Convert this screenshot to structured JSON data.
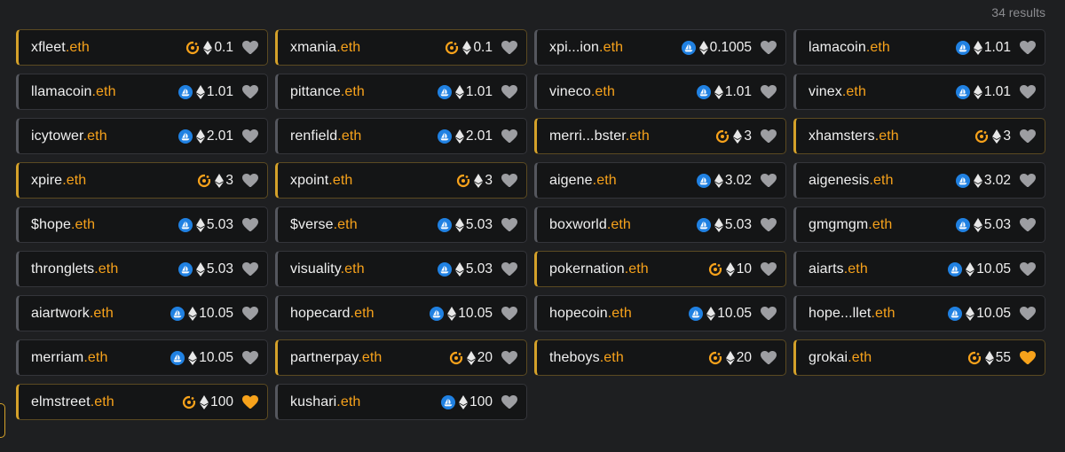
{
  "results_label": "34 results",
  "colors": {
    "tld": "#f7a21b",
    "heart_active": "#f7a21b",
    "heart_inactive": "#9d9ea2",
    "opensea_blue": "#2081e2"
  },
  "listings": [
    {
      "name": "xfleet",
      "tld": ".eth",
      "marketplace": "ens-marketplace-icon",
      "price": "0.1",
      "liked": false,
      "highlight": true
    },
    {
      "name": "xmania",
      "tld": ".eth",
      "marketplace": "ens-marketplace-icon",
      "price": "0.1",
      "liked": false,
      "highlight": true
    },
    {
      "name": "xpi...ion",
      "tld": ".eth",
      "marketplace": "opensea-icon",
      "price": "0.1005",
      "liked": false,
      "highlight": false
    },
    {
      "name": "lamacoin",
      "tld": ".eth",
      "marketplace": "opensea-icon",
      "price": "1.01",
      "liked": false,
      "highlight": false
    },
    {
      "name": "llamacoin",
      "tld": ".eth",
      "marketplace": "opensea-icon",
      "price": "1.01",
      "liked": false,
      "highlight": false
    },
    {
      "name": "pittance",
      "tld": ".eth",
      "marketplace": "opensea-icon",
      "price": "1.01",
      "liked": false,
      "highlight": false
    },
    {
      "name": "vineco",
      "tld": ".eth",
      "marketplace": "opensea-icon",
      "price": "1.01",
      "liked": false,
      "highlight": false
    },
    {
      "name": "vinex",
      "tld": ".eth",
      "marketplace": "opensea-icon",
      "price": "1.01",
      "liked": false,
      "highlight": false
    },
    {
      "name": "icytower",
      "tld": ".eth",
      "marketplace": "opensea-icon",
      "price": "2.01",
      "liked": false,
      "highlight": false
    },
    {
      "name": "renfield",
      "tld": ".eth",
      "marketplace": "opensea-icon",
      "price": "2.01",
      "liked": false,
      "highlight": false
    },
    {
      "name": "merri...bster",
      "tld": ".eth",
      "marketplace": "ens-marketplace-icon",
      "price": "3",
      "liked": false,
      "highlight": true
    },
    {
      "name": "xhamsters",
      "tld": ".eth",
      "marketplace": "ens-marketplace-icon",
      "price": "3",
      "liked": false,
      "highlight": true
    },
    {
      "name": "xpire",
      "tld": ".eth",
      "marketplace": "ens-marketplace-icon",
      "price": "3",
      "liked": false,
      "highlight": true
    },
    {
      "name": "xpoint",
      "tld": ".eth",
      "marketplace": "ens-marketplace-icon",
      "price": "3",
      "liked": false,
      "highlight": true
    },
    {
      "name": "aigene",
      "tld": ".eth",
      "marketplace": "opensea-icon",
      "price": "3.02",
      "liked": false,
      "highlight": false
    },
    {
      "name": "aigenesis",
      "tld": ".eth",
      "marketplace": "opensea-icon",
      "price": "3.02",
      "liked": false,
      "highlight": false
    },
    {
      "name": "$hope",
      "tld": ".eth",
      "marketplace": "opensea-icon",
      "price": "5.03",
      "liked": false,
      "highlight": false
    },
    {
      "name": "$verse",
      "tld": ".eth",
      "marketplace": "opensea-icon",
      "price": "5.03",
      "liked": false,
      "highlight": false
    },
    {
      "name": "boxworld",
      "tld": ".eth",
      "marketplace": "opensea-icon",
      "price": "5.03",
      "liked": false,
      "highlight": false
    },
    {
      "name": "gmgmgm",
      "tld": ".eth",
      "marketplace": "opensea-icon",
      "price": "5.03",
      "liked": false,
      "highlight": false
    },
    {
      "name": "thronglets",
      "tld": ".eth",
      "marketplace": "opensea-icon",
      "price": "5.03",
      "liked": false,
      "highlight": false
    },
    {
      "name": "visuality",
      "tld": ".eth",
      "marketplace": "opensea-icon",
      "price": "5.03",
      "liked": false,
      "highlight": false
    },
    {
      "name": "pokernation",
      "tld": ".eth",
      "marketplace": "ens-marketplace-icon",
      "price": "10",
      "liked": false,
      "highlight": true
    },
    {
      "name": "aiarts",
      "tld": ".eth",
      "marketplace": "opensea-icon",
      "price": "10.05",
      "liked": false,
      "highlight": false
    },
    {
      "name": "aiartwork",
      "tld": ".eth",
      "marketplace": "opensea-icon",
      "price": "10.05",
      "liked": false,
      "highlight": false
    },
    {
      "name": "hopecard",
      "tld": ".eth",
      "marketplace": "opensea-icon",
      "price": "10.05",
      "liked": false,
      "highlight": false
    },
    {
      "name": "hopecoin",
      "tld": ".eth",
      "marketplace": "opensea-icon",
      "price": "10.05",
      "liked": false,
      "highlight": false
    },
    {
      "name": "hope...llet",
      "tld": ".eth",
      "marketplace": "opensea-icon",
      "price": "10.05",
      "liked": false,
      "highlight": false
    },
    {
      "name": "merriam",
      "tld": ".eth",
      "marketplace": "opensea-icon",
      "price": "10.05",
      "liked": false,
      "highlight": false
    },
    {
      "name": "partnerpay",
      "tld": ".eth",
      "marketplace": "ens-marketplace-icon",
      "price": "20",
      "liked": false,
      "highlight": true
    },
    {
      "name": "theboys",
      "tld": ".eth",
      "marketplace": "ens-marketplace-icon",
      "price": "20",
      "liked": false,
      "highlight": true
    },
    {
      "name": "grokai",
      "tld": ".eth",
      "marketplace": "ens-marketplace-icon",
      "price": "55",
      "liked": true,
      "highlight": true
    },
    {
      "name": "elmstreet",
      "tld": ".eth",
      "marketplace": "ens-marketplace-icon",
      "price": "100",
      "liked": true,
      "highlight": true
    },
    {
      "name": "kushari",
      "tld": ".eth",
      "marketplace": "opensea-icon",
      "price": "100",
      "liked": false,
      "highlight": false
    }
  ]
}
